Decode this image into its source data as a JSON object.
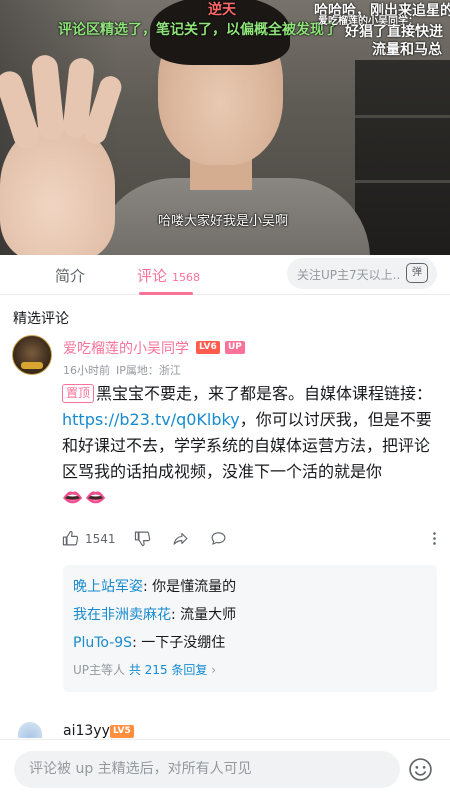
{
  "video": {
    "danmaku": [
      {
        "text": "逆天",
        "color": "red"
      },
      {
        "text": "哈哈哈，刚出来追星的",
        "color": "white"
      },
      {
        "text": "评论区精选了，笔记关了，以偏概全被发现了",
        "color": "green"
      },
      {
        "text": "爱吃榴莲的小吴同学：",
        "color": "white"
      },
      {
        "text": "好猖了直接快进",
        "color": "white"
      },
      {
        "text": "流量和马总",
        "color": "white"
      }
    ],
    "subtitle": "哈喽大家好我是小吴啊"
  },
  "tabs": {
    "intro": "简介",
    "comments": "评论",
    "comment_count": "1568",
    "danmaku_placeholder": "关注UP主7天以上...",
    "danmaku_toggle": "弹"
  },
  "comments": {
    "section_title": "精选评论",
    "pinned": {
      "username": "爱吃榴莲的小吴同学",
      "level": "LV6",
      "up_badge": "UP",
      "time": "16小时前",
      "ip_label": "IP属地：浙江",
      "pin_tag": "置顶",
      "text_before_link": "黑宝宝不要走，来了都是客。自媒体课程链接：",
      "link": "https://b23.tv/q0Klbky",
      "text_after_link": "，你可以讨厌我，但是不要和好课过不去，学学系统的自媒体运营方法，把评论区骂我的话拍成视频，没准下一个活的就是你",
      "emoji": "👄👄",
      "likes": "1541"
    },
    "replies": [
      {
        "user": "晚上站军姿",
        "text": ": 你是懂流量的"
      },
      {
        "user": "我在非洲卖麻花",
        "text": ": 流量大师"
      },
      {
        "user": "PluTo-9S",
        "text": ": 一下子没绷住"
      }
    ],
    "replies_prefix": "UP主等人",
    "replies_total": "共 215 条回复",
    "replies_chevron": "›",
    "next": {
      "username": "ai13yy",
      "level": "LV5"
    }
  },
  "bottom_bar": {
    "input_placeholder": "评论被 up 主精选后，对所有人可见"
  },
  "colors": {
    "accent_pink": "#fb7299",
    "link_blue": "#178bcf",
    "lv6_red": "#ff5c4d",
    "lv5_orange": "#ff8f3e"
  }
}
